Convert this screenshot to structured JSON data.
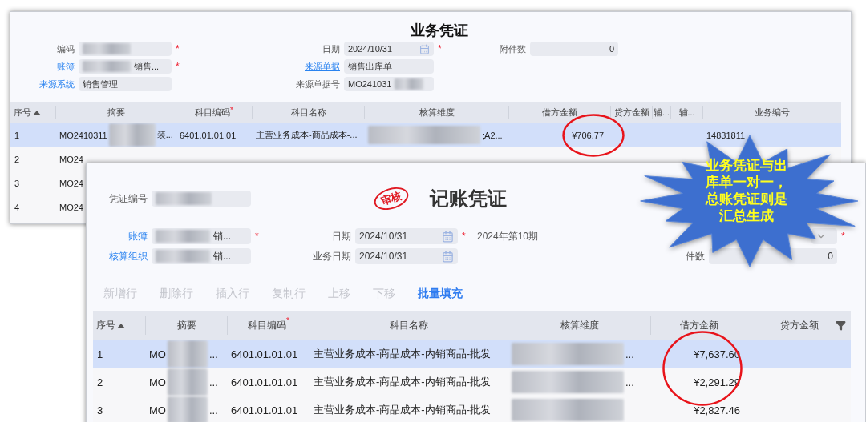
{
  "business_voucher": {
    "title": "业务凭证",
    "form_rows": [
      [
        {
          "label": "编码",
          "link": false,
          "emphasized": false,
          "blurred_start": true,
          "blurred_end": false,
          "required_mark": "*"
        },
        {
          "label": "日期",
          "link": false,
          "emphasized": false,
          "kind": "date",
          "value": "2024/10/31",
          "blurred_start": false,
          "blurred_end": false,
          "required_mark": "*"
        },
        {
          "label": "附件数",
          "link": false,
          "emphasized": false,
          "kind": "number",
          "value": "0",
          "blurred_start": false,
          "blurred_end": false
        }
      ],
      [
        {
          "label": "账簿",
          "link": false,
          "emphasized": true,
          "value": "销售...",
          "blurred_start": true,
          "blurred_end": false,
          "required_mark": "*"
        },
        {
          "label": "来源单据",
          "link": true,
          "emphasized": true,
          "value": "销售出库单",
          "blurred_start": false,
          "blurred_end": false
        }
      ],
      [
        {
          "label": "来源系统",
          "link": false,
          "emphasized": true,
          "value": "销售管理",
          "blurred_start": false,
          "blurred_end": false
        },
        {
          "label": "来源单据号",
          "link": false,
          "emphasized": false,
          "value": "MO241031",
          "blurred_start": false,
          "blurred_end": true
        }
      ]
    ],
    "columns": [
      {
        "label": "序号",
        "sorted": true
      },
      {
        "label": "摘要"
      },
      {
        "label": "科目编码",
        "required_mark": "*"
      },
      {
        "label": "科目名称"
      },
      {
        "label": "核算维度"
      },
      {
        "label": "借方金额"
      },
      {
        "label": "贷方金额"
      },
      {
        "label": "辅..."
      },
      {
        "label": "辅..."
      },
      {
        "label": "业务编号"
      }
    ],
    "rows": [
      {
        "no": "1",
        "summary": {
          "start": "MO2410311",
          "end": "装...",
          "redacted": true
        },
        "account_code": "6401.01.01.01",
        "account_name": "主营业务成本-商品成本-...",
        "dimension": {
          "text": ";A2...",
          "redacted": true
        },
        "debit": "¥706.77",
        "business_no": "14831811",
        "selected": true,
        "circled": true
      },
      {
        "no": "2",
        "summary": {
          "start": "MO24"
        },
        "selected": false
      },
      {
        "no": "3",
        "summary": {
          "start": "MO24"
        },
        "selected": false
      },
      {
        "no": "4",
        "summary": {
          "start": "MO24"
        },
        "selected": false
      }
    ]
  },
  "ledger_voucher": {
    "title": "记账凭证",
    "stamp": "审核",
    "number_field": {
      "label": "凭证编号",
      "link": false,
      "emphasized": false,
      "blurred_start": true,
      "blurred_end": false
    },
    "form_rows": [
      [
        {
          "label": "账簿",
          "link": false,
          "emphasized": true,
          "value": "销...",
          "blurred_start": true,
          "blurred_end": false,
          "required_mark": "*"
        },
        {
          "label": "日期",
          "link": false,
          "emphasized": false,
          "kind": "date",
          "value": "2024/10/31",
          "blurred_start": false,
          "blurred_end": false,
          "required_mark": "*",
          "note": "2024年第10期"
        },
        {
          "kind": "dropdown",
          "blurred_start": false,
          "blurred_end": false,
          "required_mark": "*"
        }
      ],
      [
        {
          "label": "核算组织",
          "link": false,
          "emphasized": true,
          "value": "销...",
          "blurred_start": true,
          "blurred_end": false
        },
        {
          "label": "业务日期",
          "link": false,
          "emphasized": false,
          "kind": "date",
          "value": "2024/10/31",
          "blurred_start": false,
          "blurred_end": false
        },
        {
          "label": "件数",
          "link": false,
          "emphasized": false,
          "kind": "number",
          "value": "0",
          "blurred_start": false,
          "blurred_end": false
        }
      ]
    ],
    "toolbar": [
      {
        "label": "新增行",
        "disabled": true
      },
      {
        "label": "删除行",
        "disabled": true
      },
      {
        "label": "插入行",
        "disabled": true
      },
      {
        "label": "复制行",
        "disabled": true
      },
      {
        "label": "上移",
        "disabled": true
      },
      {
        "label": "下移",
        "disabled": true
      },
      {
        "label": "批量填充",
        "disabled": false
      }
    ],
    "columns": [
      {
        "label": "序号",
        "sorted": true
      },
      {
        "label": "摘要"
      },
      {
        "label": "科目编码",
        "required_mark": "*"
      },
      {
        "label": "科目名称"
      },
      {
        "label": "核算维度"
      },
      {
        "label": "借方金额"
      },
      {
        "label": "贷方金额",
        "filter": true
      }
    ],
    "rows": [
      {
        "no": "1",
        "summary": {
          "start": "MO",
          "end": "...",
          "redacted": true
        },
        "account_code": "6401.01.01.01",
        "account_name": "主营业务成本-商品成本-内销商品-批发",
        "dimension": {
          "text": "...",
          "redacted": true
        },
        "debit": "¥7,637.60",
        "selected": true,
        "circled": true
      },
      {
        "no": "2",
        "summary": {
          "start": "MO",
          "end": "...",
          "redacted": true
        },
        "account_code": "6401.01.01.01",
        "account_name": "主营业务成本-商品成本-内销商品-批发",
        "dimension": {
          "text": "...",
          "redacted": true
        },
        "debit": "¥2,291.29",
        "selected": false,
        "circled": true
      },
      {
        "no": "3",
        "summary": {
          "start": "MO",
          "end": "...",
          "redacted": true
        },
        "account_code": "6401.01.01.01",
        "account_name": "主营业务成本-商品成本-内销商品-批发",
        "dimension": {
          "redacted": true
        },
        "debit": "¥2,827.46",
        "selected": false
      }
    ]
  },
  "callout": {
    "text": "业务凭证与出库单一对一，总账凭证则是汇总生成"
  }
}
